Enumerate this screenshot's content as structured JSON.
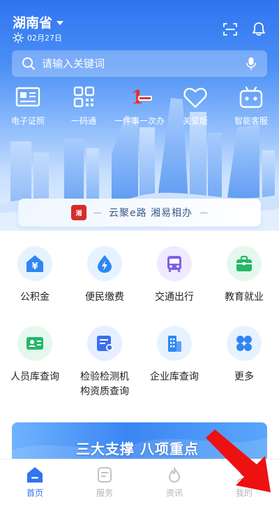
{
  "header": {
    "city": "湖南省",
    "date": "02月27日"
  },
  "search": {
    "placeholder": "请输入关键词"
  },
  "quick_actions": [
    {
      "label": "电子证照",
      "icon": "id-card-icon"
    },
    {
      "label": "一码通",
      "icon": "qr-code-icon"
    },
    {
      "label": "一件事一次办",
      "icon": "one-thing-logo-icon"
    },
    {
      "label": "关爱版",
      "icon": "heart-tag-icon"
    },
    {
      "label": "智能客服",
      "icon": "robot-icon"
    }
  ],
  "slogan": {
    "logo_text": "湘",
    "text": "云聚e路  湘易相办"
  },
  "services": [
    {
      "label": [
        "公积金"
      ],
      "icon": "yuan-house-icon",
      "bg": "#e6f3ff",
      "color": "#2f86f3"
    },
    {
      "label": [
        "便民缴费"
      ],
      "icon": "water-drop-icon",
      "bg": "#e6f3ff",
      "color": "#2f86f3"
    },
    {
      "label": [
        "交通出行"
      ],
      "icon": "bus-icon",
      "bg": "#efeaff",
      "color": "#7b62e6"
    },
    {
      "label": [
        "教育就业"
      ],
      "icon": "briefcase-icon",
      "bg": "#e5f8ee",
      "color": "#25b868"
    },
    {
      "label": [
        "人员库查询"
      ],
      "icon": "person-card-icon",
      "bg": "#e5f8ee",
      "color": "#25b868"
    },
    {
      "label": [
        "检验检测机",
        "构资质查询"
      ],
      "icon": "certificate-icon",
      "bg": "#e6efff",
      "color": "#3b6ff0"
    },
    {
      "label": [
        "企业库查询"
      ],
      "icon": "building-icon",
      "bg": "#e6f3ff",
      "color": "#2f86f3"
    },
    {
      "label": [
        "更多"
      ],
      "icon": "grid-more-icon",
      "bg": "#e6f3ff",
      "color": "#2f86f3"
    }
  ],
  "banner": {
    "text": "三大支撑 八项重点"
  },
  "tabs": [
    {
      "label": "首页",
      "icon": "home-icon",
      "active": true
    },
    {
      "label": "服务",
      "icon": "service-doc-icon",
      "active": false
    },
    {
      "label": "资讯",
      "icon": "flame-news-icon",
      "active": false
    },
    {
      "label": "我的",
      "icon": "profile-icon",
      "active": false
    }
  ],
  "colors": {
    "primary": "#2f74f0",
    "tab_inactive": "#b5b5b5",
    "annotation_arrow": "#ee1111"
  }
}
